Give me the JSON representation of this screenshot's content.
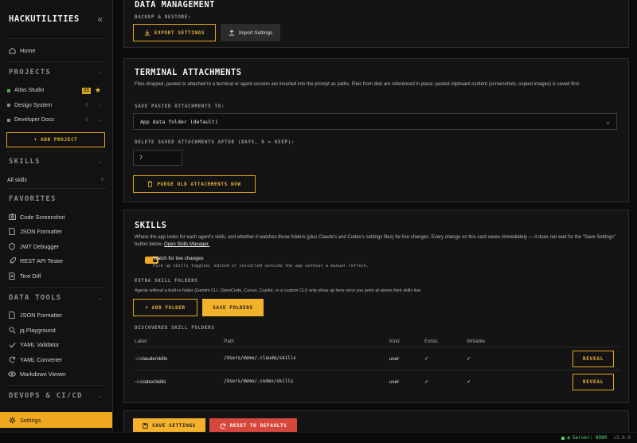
{
  "app": {
    "title": "HACKUTILITIES"
  },
  "sidebar": {
    "home": "Home",
    "projects_title": "PROJECTS",
    "projects": [
      {
        "name": "Atlas Studio",
        "badge": "21",
        "count": "0",
        "color": "#4fb34f"
      },
      {
        "name": "Design System",
        "count": "0",
        "color": "#8a8a8a"
      },
      {
        "name": "Developer Docs",
        "count": "0",
        "color": "#8a8a8a"
      }
    ],
    "add_project": "+ ADD PROJECT",
    "skills_title": "SKILLS",
    "all_skills": "All skills",
    "all_skills_count": "0",
    "favorites_title": "FAVORITES",
    "favorites": [
      "Code Screenshot",
      "JSON Formatter",
      "JWT Debugger",
      "REST API Tester",
      "Text Diff"
    ],
    "data_tools_title": "DATA TOOLS",
    "data_tools": [
      "JSON Formatter",
      "jq Playground",
      "YAML Validator",
      "YAML Converter",
      "Markdown Viewer"
    ],
    "devops_title": "DEVOPS & CI/CD",
    "settings": "Settings"
  },
  "data_management": {
    "title": "DATA MANAGEMENT",
    "backup_label": "BACKUP & RESTORE:",
    "export": "EXPORT SETTINGS",
    "import": "Import Settings"
  },
  "terminal": {
    "title": "TERMINAL ATTACHMENTS",
    "desc": "Files dropped, pasted or attached to a terminal or agent session are inserted into the prompt as paths. Files from disk are referenced in place; pasted clipboard content (screenshots, copied images) is saved first.",
    "save_label": "SAVE PASTED ATTACHMENTS TO:",
    "save_value": "App data folder (default)",
    "delete_label": "DELETE SAVED ATTACHMENTS AFTER (DAYS, 0 = KEEP):",
    "delete_value": "7",
    "purge": "PURGE OLD ATTACHMENTS NOW"
  },
  "skills": {
    "title": "SKILLS",
    "desc": "Where the app looks for each agent's skills, and whether it watches those folders (plus Claude's and Codex's settings files) for live changes. Every change on this card saves immediately — it does not wait for the \"Save Settings\" button below.",
    "desc_link": "Open Skills Manager.",
    "watch_label": "Watch for live changes",
    "watch_sub": "Pick up skills toggled, edited or installed outside the app without a manual refresh.",
    "extra_title": "EXTRA SKILL FOLDERS",
    "extra_desc": "Agents without a built-in folder (Gemini CLI, OpenCode, Cursor, Copilot, or a custom CLI) only show up here once you point at where their skills live.",
    "add_folder": "+ ADD FOLDER",
    "save_folders": "SAVE FOLDERS",
    "discovered_title": "DISCOVERED SKILL FOLDERS",
    "columns": [
      "Label",
      "Path",
      "Kind",
      "Exists",
      "Writable"
    ],
    "rows": [
      {
        "label": "~/.claude/skills",
        "path": "/Users/demo/.claude/skills",
        "kind": "user",
        "exists": "✓",
        "writable": "✓",
        "action": "REVEAL"
      },
      {
        "label": "~/.codex/skills",
        "path": "/Users/demo/.codex/skills",
        "kind": "user",
        "exists": "✓",
        "writable": "✓",
        "action": "REVEAL"
      }
    ]
  },
  "footer": {
    "save": "SAVE SETTINGS",
    "reset": "RESET TO DEFAULTS"
  },
  "status": {
    "server": "Server: 8080",
    "version": "v3.0.0"
  },
  "colors": {
    "accent": "#f0a820",
    "danger": "#d8473c",
    "ok": "#4fd16c"
  }
}
